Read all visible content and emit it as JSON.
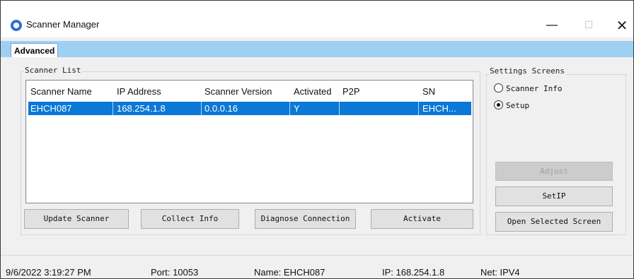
{
  "window": {
    "title": "Scanner Manager",
    "min_glyph": "—",
    "max_glyph": "☐",
    "close_glyph": "✕"
  },
  "menu": {
    "advanced": "Advanced"
  },
  "scanner_list": {
    "label": "Scanner List",
    "columns": [
      "Scanner Name",
      "IP Address",
      "Scanner Version",
      "Activated",
      "P2P",
      "SN"
    ],
    "rows": [
      [
        "EHCH087",
        "168.254.1.8",
        "0.0.0.16",
        "Y",
        "",
        "EHCH..."
      ]
    ]
  },
  "buttons": {
    "update": "Update Scanner",
    "collect": "Collect Info",
    "diagnose": "Diagnose Connection",
    "activate": "Activate",
    "disabled": "Adjust",
    "setip": "SetIP",
    "open_screen": "Open Selected Screen"
  },
  "settings_screens": {
    "label": "Settings Screens",
    "options": [
      "Scanner Info",
      "Setup"
    ],
    "selected": "Setup"
  },
  "status": {
    "datetime": "9/6/2022 3:19:27 PM",
    "port": "Port: 10053",
    "name": "Name: EHCH087",
    "ip": "IP: 168.254.1.8",
    "net": "Net: IPV4"
  },
  "colors": {
    "selection": "#0b78d7",
    "menubar": "#9fcff2"
  }
}
